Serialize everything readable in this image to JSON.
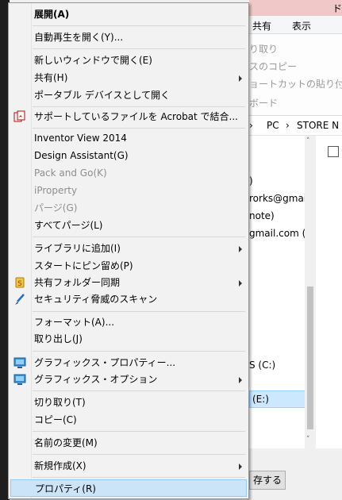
{
  "explorer": {
    "title_fragment": "ド",
    "tabs": [
      "共有",
      "表示"
    ],
    "ribbon_items": [
      "り取り",
      "スのコピー",
      "ョートカットの貼り付け",
      "ボード"
    ],
    "address": {
      "sep1": "›",
      "pc": "PC",
      "sep2": "›",
      "store": "STORE N"
    },
    "nav_items": [
      ")",
      "rorks@gmai",
      "note)",
      "gmail.com (",
      "S (C:)",
      "(E:)"
    ],
    "scroll_up": "˄",
    "scroll_down": "˅",
    "button_label": "存する"
  },
  "context_menu": {
    "items": [
      {
        "label": "展開(A)"
      },
      {
        "label": "自動再生を開く(Y)..."
      },
      {
        "label": "新しいウィンドウで開く(E)"
      },
      {
        "label": "共有(H)"
      },
      {
        "label": "ポータブル デバイスとして開く"
      },
      {
        "label": "サポートしているファイルを Acrobat で結合...",
        "icon": "acrobat-icon"
      },
      {
        "label": "Inventor View 2014"
      },
      {
        "label": "Design Assistant(G)"
      },
      {
        "label": "Pack and Go(K)"
      },
      {
        "label": "iProperty"
      },
      {
        "label": "パージ(G)"
      },
      {
        "label": "すべてパージ(L)"
      },
      {
        "label": "ライブラリに追加(I)"
      },
      {
        "label": "スタートにピン留め(P)"
      },
      {
        "label": "共有フォルダー同期",
        "icon": "sync-folder-icon"
      },
      {
        "label": "セキュリティ脅威のスキャン",
        "icon": "security-scan-icon"
      },
      {
        "label": "フォーマット(A)..."
      },
      {
        "label": "取り出し(J)"
      },
      {
        "label": "グラフィックス・プロパティー...",
        "icon": "graphics-icon"
      },
      {
        "label": "グラフィックス・オプション",
        "icon": "graphics-icon"
      },
      {
        "label": "切り取り(T)"
      },
      {
        "label": "コピー(C)"
      },
      {
        "label": "名前の変更(M)"
      },
      {
        "label": "新規作成(X)"
      },
      {
        "label": "プロパティ(R)"
      }
    ]
  }
}
